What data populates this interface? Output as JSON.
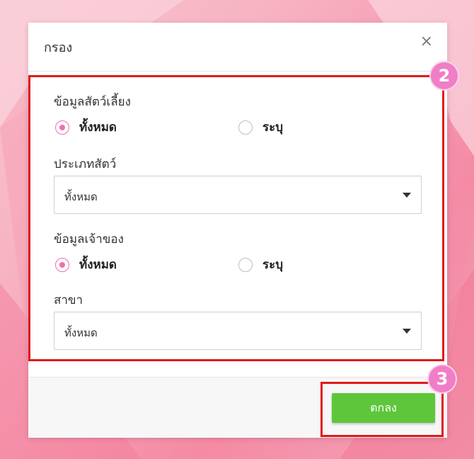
{
  "dialog": {
    "title": "กรอง",
    "close_symbol": "×"
  },
  "pet_info": {
    "label": "ข้อมูลสัตว์เลี้ยง",
    "options": [
      "ทั้งหมด",
      "ระบุ"
    ],
    "selected": "ทั้งหมด"
  },
  "pet_type": {
    "label": "ประเภทสัตว์",
    "value": "ทั้งหมด"
  },
  "owner_info": {
    "label": "ข้อมูลเจ้าของ",
    "options": [
      "ทั้งหมด",
      "ระบุ"
    ],
    "selected": "ทั้งหมด"
  },
  "branch": {
    "label": "สาขา",
    "value": "ทั้งหมด"
  },
  "footer": {
    "ok_label": "ตกลง"
  },
  "annotations": {
    "badge_body": "2",
    "badge_ok": "3"
  },
  "colors": {
    "accent_pink": "#f06fae",
    "ok_green": "#5ec63b",
    "highlight_red": "#e0191b",
    "badge_pink": "#f07ec7"
  }
}
